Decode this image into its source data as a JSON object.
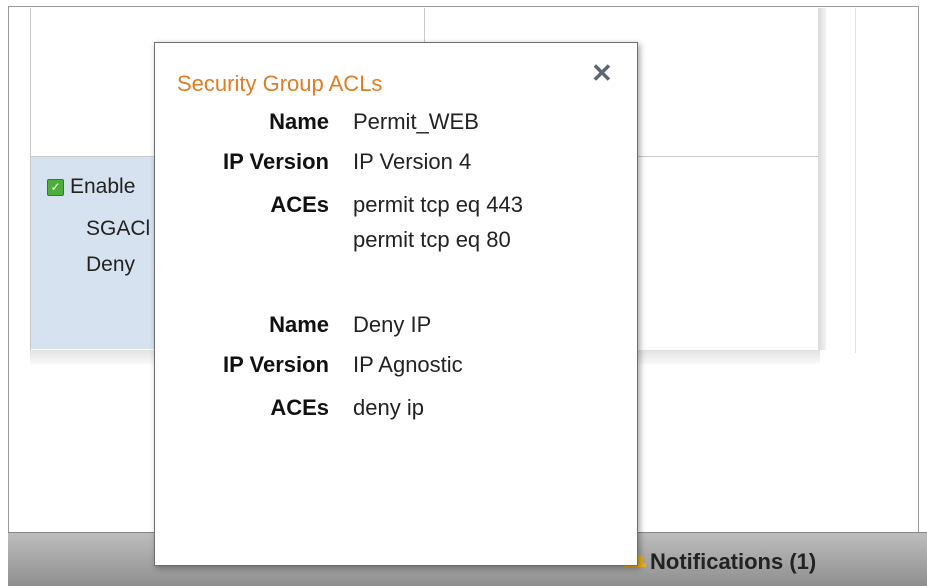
{
  "background": {
    "enable_label": "Enable",
    "line1": "SGACl",
    "line2": "Deny"
  },
  "popover": {
    "title": "Security Group ACLs",
    "close_icon": "close-icon",
    "title_color": "#e07d24",
    "entries": [
      {
        "name_label": "Name",
        "name": "Permit_WEB",
        "ipver_label": "IP Version",
        "ip_version": "IP Version 4",
        "aces_label": "ACEs",
        "aces": [
          "permit tcp eq 443",
          "permit tcp eq 80"
        ]
      },
      {
        "name_label": "Name",
        "name": "Deny IP",
        "ipver_label": "IP Version",
        "ip_version": "IP Agnostic",
        "aces_label": "ACEs",
        "aces": [
          "deny ip"
        ]
      }
    ]
  },
  "status_bar": {
    "notifications_label": "Notifications (1)",
    "icon": "notification-bell-icon"
  }
}
